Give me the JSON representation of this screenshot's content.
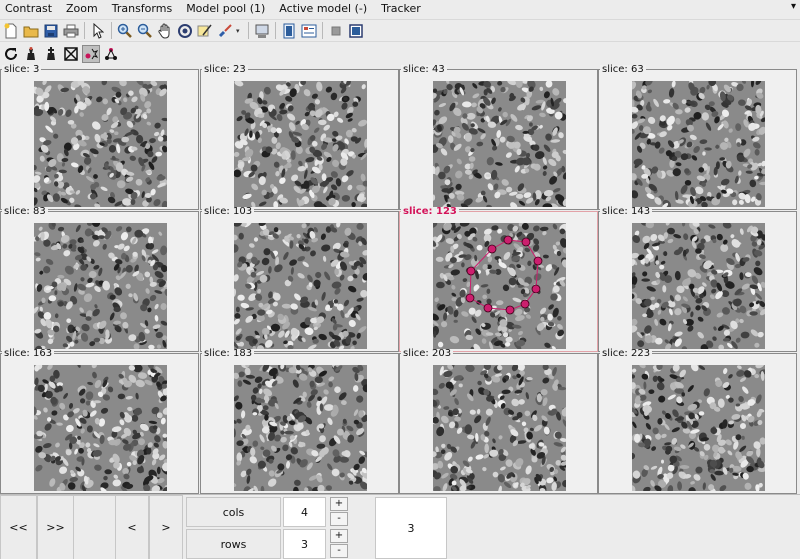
{
  "menubar": {
    "items": [
      "Contrast",
      "Zoom",
      "Transforms",
      "Model pool (1)",
      "Active model (-)",
      "Tracker"
    ],
    "overflow_icon": "triangle-down-icon"
  },
  "toolbar1": {
    "icons": [
      "new-file-icon",
      "open-folder-icon",
      "save-icon",
      "print-icon",
      "pointer-arrow-icon",
      "zoom-in-icon",
      "zoom-out-icon",
      "pan-hand-icon",
      "rotate-icon",
      "annotate-icon",
      "paint-brush-icon",
      "dropdown-icon",
      "screenshot-icon",
      "panel-icon",
      "list-icon",
      "stop-icon",
      "window-icon"
    ]
  },
  "toolbar2": {
    "icons": [
      "refresh-icon",
      "chess-piece-icon",
      "chess-king-icon",
      "crosshair-icon",
      "points-icon",
      "network-icon"
    ]
  },
  "colors": {
    "active_slice_label": "#d4145a",
    "active_border": "#e3a2a8",
    "model_points": "#cc1f6e"
  },
  "slices": [
    {
      "label": "slice: 3"
    },
    {
      "label": "slice: 23"
    },
    {
      "label": "slice: 43"
    },
    {
      "label": "slice: 63"
    },
    {
      "label": "slice: 83"
    },
    {
      "label": "slice: 103"
    },
    {
      "label": "slice: 123"
    },
    {
      "label": "slice: 143"
    },
    {
      "label": "slice: 163"
    },
    {
      "label": "slice: 183"
    },
    {
      "label": "slice: 203"
    },
    {
      "label": "slice: 223"
    }
  ],
  "active_slice_index": 6,
  "controls": {
    "first_label": "<<",
    "last_label": ">>",
    "prev_label": "<",
    "next_label": ">",
    "cols_label": "cols",
    "cols_value": "4",
    "rows_label": "rows",
    "rows_value": "3",
    "plus_label": "+",
    "minus_label": "-",
    "readout_value": "3"
  }
}
